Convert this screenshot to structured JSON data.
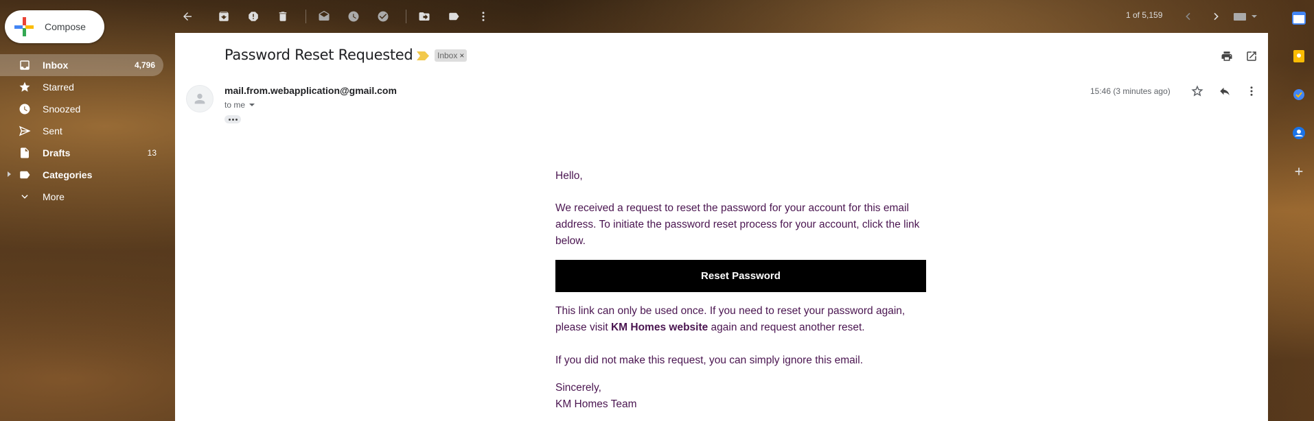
{
  "compose": {
    "label": "Compose",
    "icon": "plus-icon"
  },
  "nav": {
    "items": [
      {
        "label": "Inbox",
        "count": "4,796",
        "icon": "inbox-icon"
      },
      {
        "label": "Starred",
        "count": "",
        "icon": "star-icon"
      },
      {
        "label": "Snoozed",
        "count": "",
        "icon": "clock-icon"
      },
      {
        "label": "Sent",
        "count": "",
        "icon": "send-icon"
      },
      {
        "label": "Drafts",
        "count": "13",
        "icon": "draft-icon"
      },
      {
        "label": "Categories",
        "count": "",
        "icon": "label-icon"
      },
      {
        "label": "More",
        "count": "",
        "icon": "chevron-down-icon"
      }
    ]
  },
  "toolbar": {
    "pager": "1 of 5,159"
  },
  "email": {
    "subject": "Password Reset Requested",
    "label_chip": "Inbox",
    "label_chip_close": "×",
    "sender": "mail.from.webapplication@gmail.com",
    "to": "to me",
    "time": "15:46 (3 minutes ago)",
    "greeting": "Hello,",
    "para1": "We received a request to reset the password for your account for this email address. To initiate the password reset process for your account, click the link below.",
    "button": "Reset Password",
    "para2_pre": "This link can only be used once. If you need to reset your password again, please visit ",
    "para2_link": "KM Homes website",
    "para2_post": " again and request another reset.",
    "para3": "If you did not make this request, you can simply ignore this email.",
    "signoff": "Sincerely,",
    "signature": "KM Homes Team"
  },
  "side_panel": {
    "calendar_day": "31"
  },
  "colors": {
    "body_text": "#4a1550",
    "button_bg": "#000000",
    "important_marker": "#f2c94c"
  }
}
